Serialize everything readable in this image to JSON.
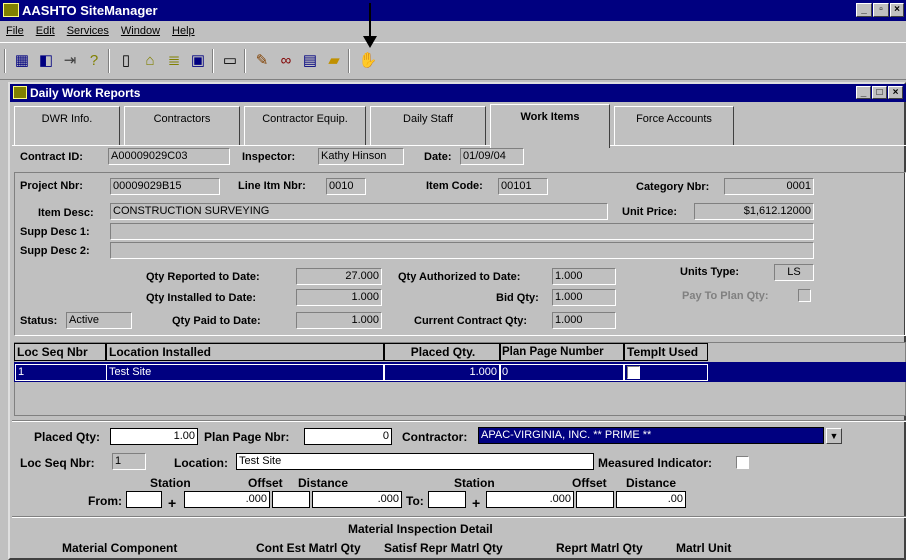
{
  "app": {
    "title": "AASHTO SiteManager"
  },
  "menu": [
    "File",
    "Edit",
    "Services",
    "Window",
    "Help"
  ],
  "subwindow": {
    "title": "Daily Work Reports"
  },
  "tabs": [
    "DWR Info.",
    "Contractors",
    "Contractor Equip.",
    "Daily Staff",
    "Work Items",
    "Force Accounts"
  ],
  "header": {
    "contract_label": "Contract ID:",
    "contract_value": "A00009029C03",
    "inspector_label": "Inspector:",
    "inspector_value": "Kathy Hinson",
    "date_label": "Date:",
    "date_value": "01/09/04"
  },
  "detail": {
    "project_label": "Project Nbr:",
    "project_value": "00009029B15",
    "line_label": "Line Itm Nbr:",
    "line_value": "0010",
    "item_code_label": "Item Code:",
    "item_code_value": "00101",
    "category_label": "Category Nbr:",
    "category_value": "0001",
    "item_desc_label": "Item Desc:",
    "item_desc_value": "CONSTRUCTION SURVEYING",
    "unit_price_label": "Unit Price:",
    "unit_price_value": "$1,612.12000",
    "supp1_label": "Supp Desc 1:",
    "supp1_value": "",
    "supp2_label": "Supp Desc 2:",
    "supp2_value": "",
    "qty_reported_label": "Qty Reported to Date:",
    "qty_reported_value": "27.000",
    "qty_installed_label": "Qty Installed to Date:",
    "qty_installed_value": "1.000",
    "qty_paid_label": "Qty Paid to Date:",
    "qty_paid_value": "1.000",
    "qty_auth_label": "Qty Authorized to Date:",
    "qty_auth_value": "1.000",
    "bid_qty_label": "Bid Qty:",
    "bid_qty_value": "1.000",
    "cur_contract_label": "Current Contract Qty:",
    "cur_contract_value": "1.000",
    "units_type_label": "Units Type:",
    "units_type_value": "LS",
    "pay_to_plan_label": "Pay To Plan Qty:",
    "status_label": "Status:",
    "status_value": "Active"
  },
  "grid": {
    "columns": [
      "Loc Seq Nbr",
      "Location Installed",
      "Placed Qty.",
      "Plan Page Number",
      "Templt Used"
    ],
    "rows": [
      {
        "seq": "1",
        "location": "Test Site",
        "placed": "1.000",
        "plan_page": "0"
      }
    ]
  },
  "edit": {
    "placed_label": "Placed Qty:",
    "placed_value": "1.00",
    "plan_page_label": "Plan Page Nbr:",
    "plan_page_value": "0",
    "contractor_label": "Contractor:",
    "contractor_value": "APAC-VIRGINIA, INC.  ** PRIME **",
    "loc_seq_label": "Loc Seq Nbr:",
    "loc_seq_value": "1",
    "location_label": "Location:",
    "location_value": "Test Site",
    "measured_label": "Measured Indicator:",
    "station_label": "Station",
    "offset_label": "Offset",
    "distance_label": "Distance",
    "from_label": "From:",
    "to_label": "To:",
    "plus": "+",
    "from_offset": ".000",
    "from_distance": ".000",
    "to_offset": ".000",
    "to_distance": ".00"
  },
  "material": {
    "title": "Material Inspection Detail",
    "columns": [
      "Material Component",
      "Cont Est Matrl Qty",
      "Satisf Repr Matrl Qty",
      "Reprt Matrl Qty",
      "Matrl Unit"
    ]
  }
}
